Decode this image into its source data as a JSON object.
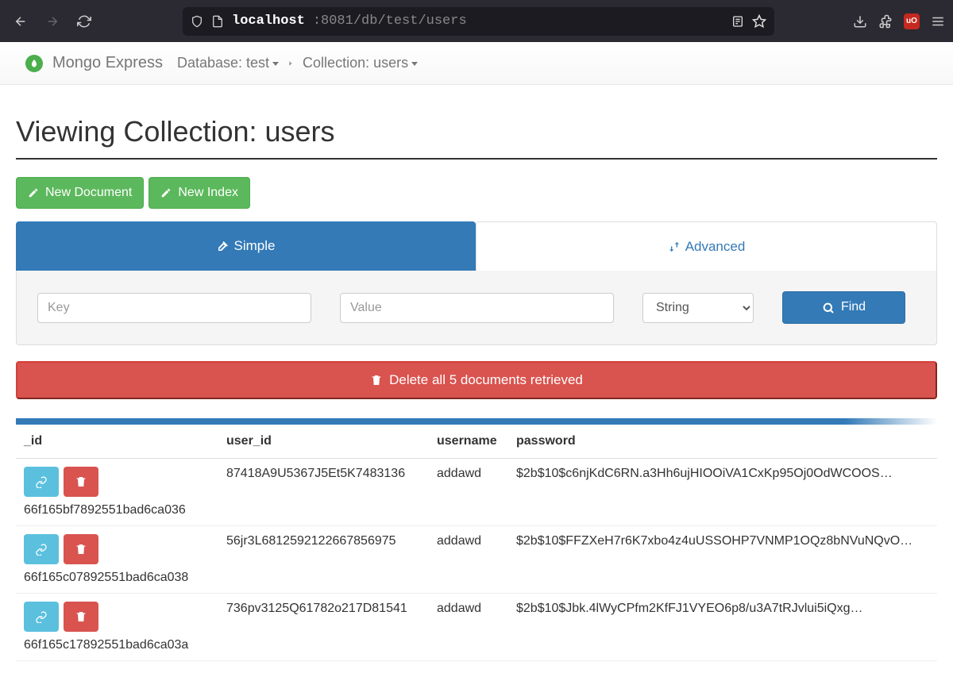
{
  "browser": {
    "url_host": "localhost",
    "url_path": ":8081/db/test/users"
  },
  "navbar": {
    "brand": "Mongo Express",
    "database_label": "Database: test",
    "collection_label": "Collection: users"
  },
  "page": {
    "title": "Viewing Collection: users"
  },
  "buttons": {
    "new_document": "New Document",
    "new_index": "New Index",
    "find": "Find",
    "delete_all": "Delete all 5 documents retrieved"
  },
  "tabs": {
    "simple": "Simple",
    "advanced": "Advanced"
  },
  "search": {
    "key_placeholder": "Key",
    "value_placeholder": "Value",
    "type_selected": "String"
  },
  "table": {
    "columns": [
      "_id",
      "user_id",
      "username",
      "password"
    ],
    "rows": [
      {
        "_id": "66f165bf7892551bad6ca036",
        "user_id": "87418A9U5367J5Et5K7483136",
        "username": "addawd",
        "password": "$2b$10$c6njKdC6RN.a3Hh6ujHIOOiVA1CxKp95Oj0OdWCOOS…"
      },
      {
        "_id": "66f165c07892551bad6ca038",
        "user_id": "56jr3L6812592122667856975",
        "username": "addawd",
        "password": "$2b$10$FFZXeH7r6K7xbo4z4uUSSOHP7VNMP1OQz8bNVuNQvO…"
      },
      {
        "_id": "66f165c17892551bad6ca03a",
        "user_id": "736pv3125Q61782o217D81541",
        "username": "addawd",
        "password": "$2b$10$Jbk.4lWyCPfm2KfFJ1VYEO6p8/u3A7tRJvlui5iQxg…"
      }
    ]
  }
}
